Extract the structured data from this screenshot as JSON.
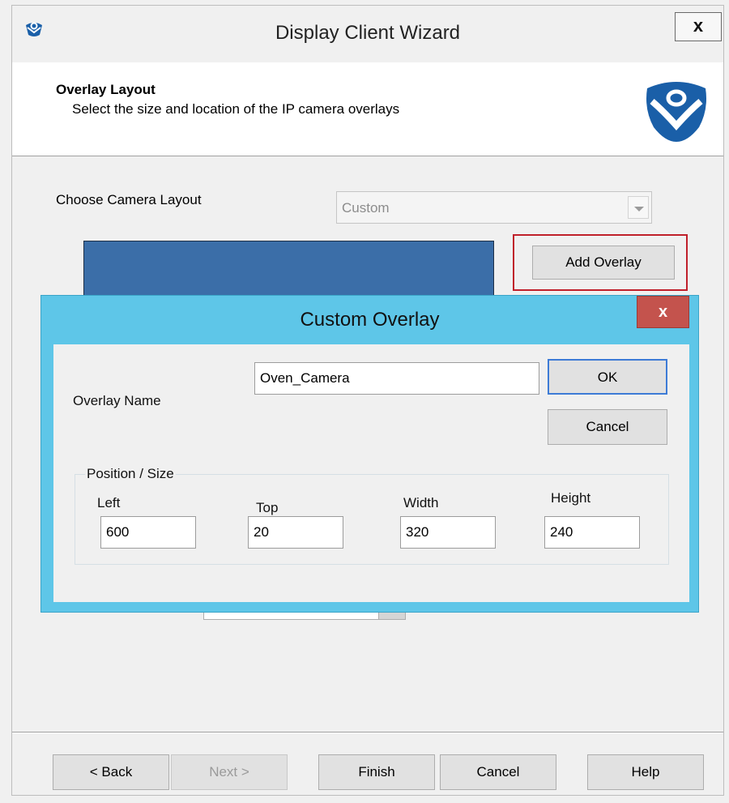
{
  "wizard": {
    "title": "Display Client Wizard",
    "close_label": "x",
    "header": {
      "title": "Overlay Layout",
      "subtitle": "Select the size and location of the IP camera overlays"
    },
    "camera_layout": {
      "label": "Choose Camera Layout",
      "value": "Custom"
    },
    "add_overlay_label": "Add Overlay",
    "nav": {
      "back": "< Back",
      "next": "Next >",
      "finish": "Finish",
      "cancel": "Cancel",
      "help": "Help"
    },
    "colors": {
      "preview_blue": "#3b6ea8",
      "highlight_red": "#c0202b"
    }
  },
  "dialog": {
    "title": "Custom Overlay",
    "close_label": "x",
    "overlay_name_label": "Overlay Name",
    "overlay_name_value": "Oven_Camera",
    "ok_label": "OK",
    "cancel_label": "Cancel",
    "group_label": "Position / Size",
    "fields": {
      "left": {
        "label": "Left",
        "value": "600"
      },
      "top": {
        "label": "Top",
        "value": "20"
      },
      "width": {
        "label": "Width",
        "value": "320"
      },
      "height": {
        "label": "Height",
        "value": "240"
      }
    },
    "colors": {
      "frame": "#5ec6e8",
      "close": "#c4534d"
    }
  }
}
